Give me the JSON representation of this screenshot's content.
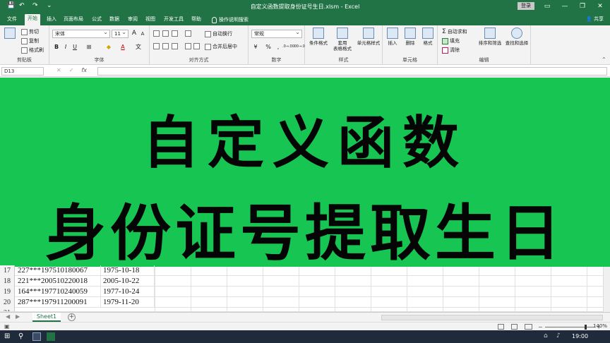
{
  "window": {
    "title": "自定义函数提取身份证号生日.xlsm - Excel",
    "login_label": "登录",
    "controls": [
      "▭",
      "—",
      "❐",
      "✕"
    ]
  },
  "quick_access": {
    "save_icon": "save-icon",
    "undo_icon": "undo-icon",
    "redo_icon": "redo-icon"
  },
  "ribbon_tabs": [
    "文件",
    "开始",
    "插入",
    "页面布局",
    "公式",
    "数据",
    "审阅",
    "视图",
    "开发工具",
    "帮助"
  ],
  "tell_me": "操作说明搜索",
  "share": "共享",
  "ribbon": {
    "clipboard": {
      "label": "剪贴板",
      "cut": "剪切",
      "copy": "复制",
      "format_painter": "格式刷",
      "paste_icon": "paste-icon"
    },
    "font": {
      "label": "字体",
      "font_name": "宋体",
      "font_size": "11",
      "bold": "B",
      "italic": "I",
      "underline": "U",
      "grow": "A",
      "shrink": "A",
      "font_color": "A",
      "fill": "◆",
      "border": "⊞",
      "phonetic": "文"
    },
    "alignment": {
      "label": "对齐方式",
      "wrap": "自动换行",
      "merge": "合并后居中"
    },
    "number": {
      "label": "数字",
      "format": "常规",
      "percent": "%",
      "comma": ",",
      "currency": "¥",
      "inc_decimal": ".0→.00",
      "dec_decimal": ".00→.0"
    },
    "styles": {
      "label": "样式",
      "conditional": "条件格式",
      "table_line1": "套用",
      "table_line2": "表格格式",
      "cell_styles": "单元格样式"
    },
    "cells": {
      "label": "单元格",
      "insert": "插入",
      "delete": "删除",
      "format": "格式"
    },
    "editing": {
      "label": "编辑",
      "autosum": "自动求和",
      "fill": "填充",
      "clear": "清除",
      "sort_filter": "排序和筛选",
      "find_select": "查找和选择"
    }
  },
  "formula_bar": {
    "name_box": "D13",
    "cancel": "✕",
    "enter": "✓",
    "fx": "fx",
    "value": ""
  },
  "banner": {
    "line1": "自定义函数",
    "line2": "身份证号提取生日",
    "background": "#17c553"
  },
  "sheet": {
    "rows": [
      {
        "num": "17",
        "id": "227***197510180067",
        "date": "1975-10-18"
      },
      {
        "num": "18",
        "id": "221***200510220018",
        "date": "2005-10-22"
      },
      {
        "num": "19",
        "id": "164***197710240059",
        "date": "1977-10-24"
      },
      {
        "num": "20",
        "id": "287***197911200091",
        "date": "1979-11-20"
      },
      {
        "num": "21",
        "id": "",
        "date": ""
      }
    ],
    "tab_name": "Sheet1",
    "add_sheet": "+"
  },
  "status": {
    "zoom": "140%",
    "zoom_fraction": 0.8
  },
  "taskbar": {
    "time": "19:00"
  },
  "colors": {
    "excel_green": "#217346",
    "banner_green": "#17c553"
  }
}
